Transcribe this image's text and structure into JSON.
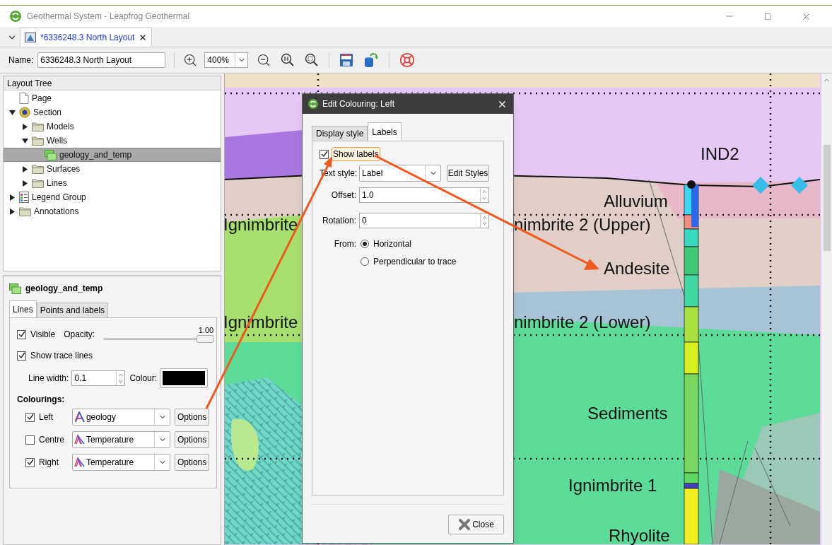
{
  "window": {
    "title": "Geothermal System - Leapfrog Geothermal"
  },
  "document_tab": {
    "label": "*6336248.3 North Layout",
    "selected": true
  },
  "toolbar": {
    "name_label": "Name:",
    "name_value": "6336248.3 North Layout",
    "zoom_value": "400%"
  },
  "layout_tree": {
    "title": "Layout Tree",
    "items": [
      {
        "label": "Page",
        "kind": "page",
        "selected": false
      },
      {
        "label": "Section",
        "kind": "section",
        "selected": false,
        "expanded": true,
        "children": [
          {
            "label": "Models",
            "kind": "folder",
            "selected": false,
            "expanded": false
          },
          {
            "label": "Wells",
            "kind": "folder",
            "selected": false,
            "expanded": true,
            "children": [
              {
                "label": "geology_and_temp",
                "kind": "wells",
                "selected": true
              }
            ]
          },
          {
            "label": "Surfaces",
            "kind": "folder",
            "selected": false,
            "expanded": false
          },
          {
            "label": "Lines",
            "kind": "folder",
            "selected": false,
            "expanded": false
          }
        ]
      },
      {
        "label": "Legend Group",
        "kind": "legend",
        "selected": false,
        "expanded": false
      },
      {
        "label": "Annotations",
        "kind": "folder",
        "selected": false,
        "expanded": false
      }
    ]
  },
  "properties": {
    "title": "geology_and_temp",
    "tabs": [
      {
        "label": "Lines",
        "selected": true
      },
      {
        "label": "Points and labels",
        "selected": false
      }
    ],
    "visible": {
      "label": "Visible",
      "checked": true
    },
    "opacity": {
      "label": "Opacity:",
      "reading": "1.00",
      "level": 1
    },
    "show_trace_lines": {
      "label": "Show trace lines",
      "checked": true
    },
    "line_width": {
      "label": "Line width:",
      "value": "0.1"
    },
    "colour": {
      "label": "Colour:",
      "color": "#000000"
    },
    "colourings": {
      "title": "Colourings:",
      "rows": [
        {
          "label": "Left",
          "checked": true,
          "value": "geology",
          "kind": "category",
          "button": "Options"
        },
        {
          "label": "Centre",
          "checked": false,
          "value": "Temperature",
          "kind": "numeric",
          "button": "Options"
        },
        {
          "label": "Right",
          "checked": true,
          "value": "Temperature",
          "kind": "numeric",
          "button": "Options"
        }
      ]
    }
  },
  "section_labels": [
    {
      "text": "IND2"
    },
    {
      "text": "Alluvium"
    },
    {
      "text": "Ignimbrite"
    },
    {
      "text": "nimbrite 2 (Upper)"
    },
    {
      "text": "Andesite"
    },
    {
      "text": "Ignimbrite"
    },
    {
      "text": "nimbrite 2 (Lower)"
    },
    {
      "text": "Sediments"
    },
    {
      "text": "Ignimbrite 1"
    },
    {
      "text": "Rhyolite"
    }
  ],
  "dialog": {
    "title": "Edit Colouring: Left",
    "tabs": [
      {
        "label": "Display style",
        "selected": false
      },
      {
        "label": "Labels",
        "selected": true
      }
    ],
    "show_labels": {
      "label": "Show labels",
      "checked": true
    },
    "text_style": {
      "label": "Text style:",
      "value": "Label",
      "button": "Edit Styles"
    },
    "offset": {
      "label": "Offset:",
      "value": "1.0"
    },
    "rotation": {
      "label": "Rotation:",
      "value": "0"
    },
    "from": {
      "label": "From:",
      "options": [
        {
          "label": "Horizontal",
          "selected": true
        },
        {
          "label": "Perpendicular to trace",
          "selected": false
        }
      ]
    },
    "close_button": "Close"
  }
}
